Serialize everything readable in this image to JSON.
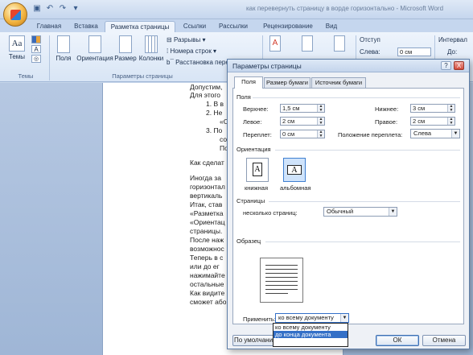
{
  "app": {
    "title": "как перевернуть страницу в ворде горизонтально - Microsoft Word",
    "qat_icons": [
      "save-icon",
      "undo-icon",
      "redo-icon",
      "customize-icon"
    ]
  },
  "tabs": [
    "Главная",
    "Вставка",
    "Разметка страницы",
    "Ссылки",
    "Рассылки",
    "Рецензирование",
    "Вид"
  ],
  "active_tab": "Разметка страницы",
  "ribbon": {
    "themes_button": "Темы",
    "themes_group": "Темы",
    "fields": "Поля",
    "orientation": "Ориентация",
    "size": "Размер",
    "columns": "Колонки",
    "breaks": "Разрывы",
    "line_numbers": "Номера строк",
    "hyphenation": "Расстановка перен",
    "page_setup_group": "Параметры страницы",
    "watermark_label": "Подложк",
    "indent_label": "Отступ",
    "indent_left_label": "Слева:",
    "indent_left_value": "0 см",
    "spacing_label": "Интервал",
    "spacing_before_label": "До:"
  },
  "document": {
    "lines": [
      "Допустим,",
      "Для этого",
      "1.   В в",
      "2.   Не",
      "«О",
      "3.   По",
      "сос",
      "По",
      "Как сделат",
      "Иногда  за",
      "горизонтал",
      "вертикаль",
      "Итак, став",
      "«Разметка",
      "«Ориентац",
      "страницы.",
      "После наж",
      "возможнос",
      "Теперь в с",
      "или  до  ег",
      "нажимайте",
      "остальные",
      "Как видите",
      "сможет або"
    ]
  },
  "dialog": {
    "title": "Параметры страницы",
    "help_button": "?",
    "close_button": "X",
    "tabs": [
      "Поля",
      "Размер бумаги",
      "Источник бумаги"
    ],
    "active_tab": "Поля",
    "margins_section": "Поля",
    "top_label": "Верхнее:",
    "top_value": "1,5 см",
    "bottom_label": "Нижнее:",
    "bottom_value": "3 см",
    "left_label": "Левое:",
    "left_value": "2 см",
    "right_label": "Правое:",
    "right_value": "2 см",
    "gutter_label": "Переплет:",
    "gutter_value": "0 см",
    "gutter_pos_label": "Положение переплета:",
    "gutter_pos_value": "Слева",
    "orientation_section": "Ориентация",
    "portrait": "книжная",
    "landscape": "альбомная",
    "selected_orientation": "альбомная",
    "pages_section": "Страницы",
    "multiple_pages_label": "несколько страниц:",
    "multiple_pages_value": "Обычный",
    "preview_section": "Образец",
    "apply_label": "Применить:",
    "apply_value": "ко всему документу",
    "apply_options": [
      "ко всему документу",
      "до конца документа"
    ],
    "highlighted_option": "до конца документа",
    "default_button": "По умолчани",
    "ok_button": "ОК",
    "cancel_button": "Отмена"
  }
}
